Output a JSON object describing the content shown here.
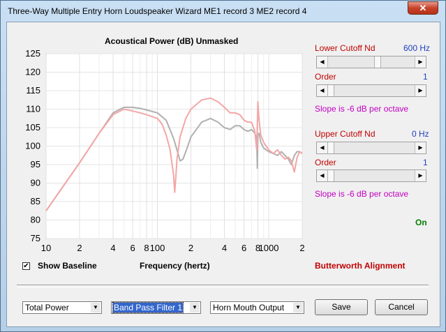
{
  "window": {
    "title": "Three-Way Multiple Entry Horn Loudspeaker Wizard   ME1 record 3   ME2 record 4",
    "close_label": "✕"
  },
  "chart": {
    "title": "Acoustical Power (dB)   Unmasked",
    "xlabel": "Frequency (hertz)",
    "x_tick_labels": [
      "10",
      "2",
      "4",
      "6",
      "8",
      "100",
      "2",
      "4",
      "6",
      "8",
      "1000",
      "2"
    ],
    "y_tick_labels": [
      "125",
      "120",
      "115",
      "110",
      "105",
      "100",
      "95",
      "90",
      "85",
      "80",
      "75"
    ]
  },
  "chart_data": {
    "type": "line",
    "xlabel": "Frequency (hertz)",
    "ylabel": "Acoustical Power (dB)",
    "xscale": "log",
    "xlim": [
      10,
      2000
    ],
    "ylim": [
      75,
      125
    ],
    "grid": true,
    "series": [
      {
        "color": "#b0b0b0",
        "x": [
          10,
          20,
          30,
          40,
          50,
          60,
          70,
          80,
          100,
          120,
          140,
          155,
          160,
          170,
          185,
          200,
          250,
          300,
          350,
          400,
          450,
          500,
          550,
          600,
          650,
          700,
          750,
          780,
          790,
          800,
          820,
          850,
          900,
          1000,
          1100,
          1200,
          1300,
          1400,
          1500,
          1600,
          1700,
          1800,
          1900,
          2000
        ],
        "y": [
          82.5,
          95.5,
          103.5,
          109,
          110.5,
          110.5,
          110.2,
          109.8,
          109,
          107,
          102,
          97.5,
          96,
          96.5,
          99.5,
          102.5,
          106.5,
          107.5,
          106.5,
          105,
          104.5,
          105.5,
          105.5,
          104.5,
          104,
          104.5,
          103.5,
          102,
          94,
          103,
          103.5,
          101,
          99.5,
          98.5,
          98,
          97.5,
          98.5,
          97.5,
          96.5,
          95,
          97.5,
          98.5,
          98.5,
          98
        ]
      },
      {
        "color": "#f4a6a6",
        "x": [
          10,
          20,
          30,
          40,
          50,
          60,
          70,
          80,
          100,
          110,
          120,
          130,
          140,
          143,
          146,
          150,
          160,
          180,
          200,
          250,
          300,
          350,
          400,
          450,
          500,
          550,
          600,
          650,
          700,
          750,
          780,
          800,
          820,
          850,
          900,
          1000,
          1100,
          1200,
          1300,
          1400,
          1500,
          1600,
          1700,
          1800,
          1900,
          2000
        ],
        "y": [
          82.5,
          95.5,
          103.5,
          108.5,
          110,
          109.5,
          109,
          108.5,
          107.5,
          106,
          103,
          99,
          92,
          87.5,
          91,
          96.5,
          102.5,
          107.5,
          110,
          112.5,
          113,
          112,
          110.5,
          109,
          109,
          108.5,
          107,
          106.5,
          106.5,
          104,
          99,
          112,
          107,
          103,
          101,
          99,
          98,
          99,
          97.5,
          96.5,
          97,
          96,
          93,
          97,
          98.5,
          98
        ]
      }
    ]
  },
  "controls": {
    "lower_cutoff_label": "Lower Cutoff  Nd",
    "lower_cutoff_value": "600 Hz",
    "lower_cutoff_level": 0.58,
    "order1_label": "Order",
    "order1_value": "1",
    "order1_level": 0.0,
    "slope1_text": "Slope is -6 dB per octave",
    "upper_cutoff_label": "Upper Cutoff  Nd",
    "upper_cutoff_value": "0 Hz",
    "upper_cutoff_level": 0.0,
    "order2_label": "Order",
    "order2_value": "1",
    "order2_level": 0.0,
    "slope2_text": "Slope is -6 dB per octave",
    "on_text": "On",
    "alignment_text": "Butterworth Alignment"
  },
  "show_baseline": {
    "label": "Show Baseline",
    "checked": true,
    "check_glyph": "✔"
  },
  "bottom": {
    "power_select": "Total Power",
    "filter_select": "Band Pass Filter 1",
    "output_select": "Horn Mouth Output",
    "dropdown_glyph": "▼",
    "save_label": "Save",
    "cancel_label": "Cancel"
  },
  "colors": {
    "baseline_series": "#b0b0b0",
    "filtered_series": "#f4a6a6",
    "label_red": "#c00000",
    "label_blue": "#1f3fbf",
    "label_magenta": "#c000c0",
    "label_green": "#008000"
  }
}
